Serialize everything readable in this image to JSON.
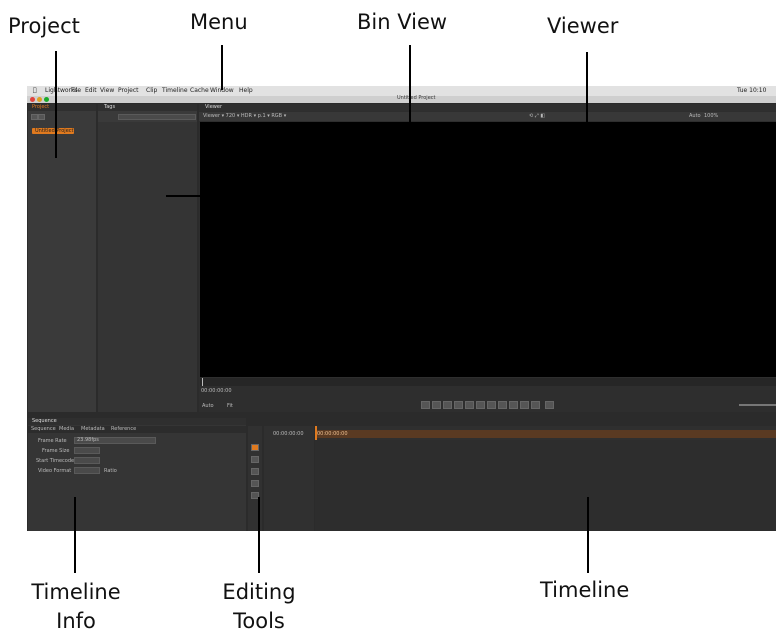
{
  "callouts": {
    "project": "Project",
    "menu": "Menu",
    "bin_view": "Bin View",
    "viewer": "Viewer",
    "timeline_info_line1": "Timeline",
    "timeline_info_line2": "Info",
    "editing_tools_line1": "Editing",
    "editing_tools_line2": "Tools",
    "timeline": "Timeline"
  },
  "menu_bar": {
    "apple": "",
    "items": [
      "Lightworks",
      "File",
      "Edit",
      "View",
      "Project",
      "Clip",
      "Timeline",
      "Cache",
      "Window",
      "Help"
    ],
    "clock": "Tue 10:10"
  },
  "window_title": "Untitled Project",
  "project_panel": {
    "tab_label": "Project",
    "tags_tab": "Tags",
    "selected_item": "Untitled Project"
  },
  "viewer": {
    "tab_label": "Viewer",
    "toolbar_left": "Viewer ▾ 720 ▾ HDR ▾ p.1 ▾ RGB ▾",
    "zoom": "Auto",
    "zoom_value": "100%",
    "timecode": "00:00:00:00",
    "bottom_left": "Auto",
    "bottom_left2": "Fit"
  },
  "sequence_panel": {
    "tab_label": "Sequence",
    "tabs": [
      "Sequence",
      "Media",
      "Metadata",
      "Reference"
    ],
    "fields": [
      {
        "label": "Frame Rate",
        "value": "23.98fps"
      },
      {
        "label": "Frame Size",
        "value": ""
      },
      {
        "label": "Start Timecode",
        "value": ""
      },
      {
        "label": "Video Format",
        "value": "Ratio"
      }
    ]
  },
  "timeline": {
    "timecode": "00:00:00:00",
    "ruler_start": "00:00:00:00"
  },
  "colors": {
    "accent": "#e07a1f",
    "panel_bg": "#3a3a3a",
    "viewer_bg": "#000000"
  }
}
